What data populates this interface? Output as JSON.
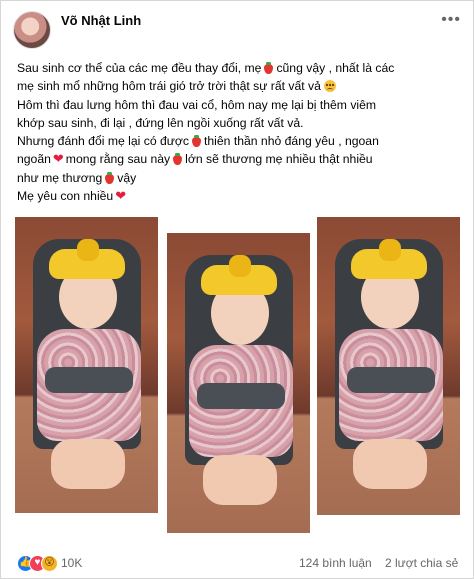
{
  "post": {
    "author": "Võ Nhật Linh",
    "more_icon": "more-horizontal-icon",
    "lines": {
      "l1a": "Sau sinh cơ thể của các mẹ đều thay đổi,  mẹ",
      "l1b": "cũng vậy , nhất là các",
      "l2": "mẹ sinh mổ những hôm trái gió trở trời thật sự rất vất vả",
      "l3": "Hôm thì đau lưng hôm thì đau vai cổ, hôm nay mẹ lại bị thêm viêm",
      "l4": "khớp sau sinh, đi lại , đứng lên ngồi xuống rất vất vả.",
      "l5a": "Nhưng đánh đổi mẹ lại có được",
      "l5b": "thiên thần nhỏ đáng yêu , ngoan",
      "l6a": "ngoãn",
      "l6b": "mong rằng sau này",
      "l6c": "lớn sẽ thương mẹ nhiều thật nhiều",
      "l7a": "như mẹ thương",
      "l7b": "vậy",
      "l8": "Mẹ yêu con nhiều"
    },
    "heart_glyph": "❤",
    "photos": [
      "photo-1",
      "photo-2",
      "photo-3"
    ]
  },
  "footer": {
    "reaction_icons": [
      "like-icon",
      "love-icon",
      "wow-icon"
    ],
    "like_glyph": "👍",
    "love_glyph": "♥",
    "wow_glyph": "😮",
    "reaction_count": "10K",
    "comments": "124 bình luận",
    "shares": "2 lượt chia sẻ"
  },
  "colors": {
    "like": "#1877f2",
    "love": "#f33e58",
    "wow": "#f7b125",
    "text": "#050505",
    "muted": "#65676b"
  }
}
